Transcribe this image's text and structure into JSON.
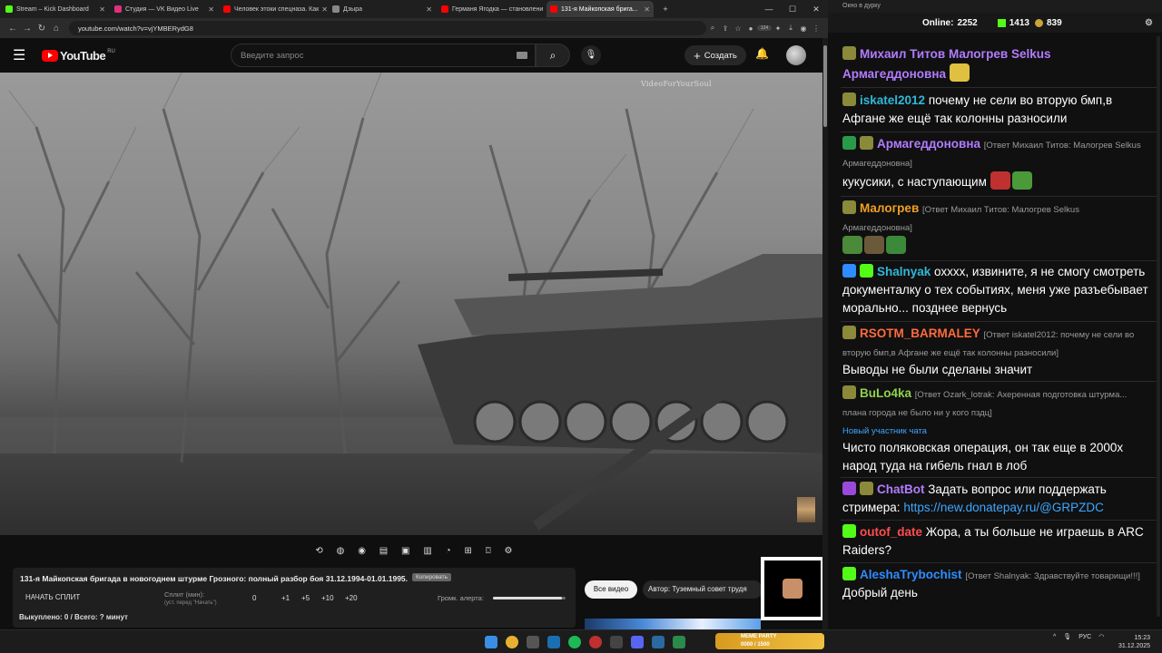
{
  "browser": {
    "tabs": [
      {
        "label": "Stream – Kick Dashboard",
        "color": "#53fc18"
      },
      {
        "label": "Студия — VK Видео Live",
        "color": "#e0307a"
      },
      {
        "label": "Человек этоки спецназа. Как",
        "color": "#ff0000"
      },
      {
        "label": "Дзыра",
        "color": "#888888"
      },
      {
        "label": "Германя Ягодка — становлени",
        "color": "#ff0000"
      },
      {
        "label": "131-я Майкопская брига...",
        "color": "#ff0000"
      }
    ],
    "url": "youtube.com/watch?v=vjYMBERydG8",
    "ext_badge": "124"
  },
  "youtube": {
    "logo_text": "YouTube",
    "region": "RU",
    "search_placeholder": "Введите запрос",
    "create_label": "Создать"
  },
  "video": {
    "watermark": "VideoForYourSoul"
  },
  "panel": {
    "title": "131-я Майкопская бригада в новогоднем штурме Грозного: полный разбор боя 31.12.1994-01.01.1995.",
    "badge": "Копировать",
    "split_button": "НАЧАТЬ СПЛИТ",
    "split_label": "Сплит (мин):",
    "split_sub": "(уст. перед \"Начать\")",
    "split_value": "0",
    "increments": [
      "+1",
      "+5",
      "+10",
      "+20"
    ],
    "alert_label": "Громк. алерта:",
    "alert_volume": 0.95,
    "bought": "Выкуплено: 0 / Всего: ? минут",
    "all_video": "Все видео",
    "author": "Автор: Туземный совет трудя"
  },
  "chat": {
    "window_title": "Окно в дурку",
    "online_label": "Online:",
    "online_value": "2252",
    "kick_count": "1413",
    "gold_count": "839",
    "messages": [
      {
        "name": "Михаил Титов",
        "text": "Малогрев Selkus Армагеддоновна",
        "color": "#b27cff"
      },
      {
        "name": "iskatel2012",
        "text": "почему не сели во вторую бмп,в Афгане же ещё так колонны разносили",
        "color": "#2fb8d9"
      },
      {
        "name": "Армагеддоновна",
        "reply": "[Ответ Михаил Титов: Малогрев Selkus Армагеддоновна]",
        "text": "кукусики, с наступающим",
        "color": "#b27cff"
      },
      {
        "name": "Малогрев",
        "reply": "[Ответ Михаил Титов: Малогрев Selkus Армагеддоновна]",
        "text": "",
        "color": "#f0a020"
      },
      {
        "name": "Shalnyak",
        "text": "охххх, извините, я не смогу смотреть документалку о тех событиях, меня уже разъебывает морально... позднее вернусь",
        "color": "#2fb8d9"
      },
      {
        "name": "RSOTM_BARMALEY",
        "reply": "[Ответ iskatel2012: почему не сели во вторую бмп,в Афгане же ещё так колонны разносили]",
        "text": "Выводы не были сделаны значит",
        "color": "#ff6a3d"
      },
      {
        "name": "BuLo4ka",
        "reply": "[Ответ Ozark_lotrak: Ахеренная подготовка штурма... плана города не было ни у кого пздц]",
        "new_member": "Новый участник чата",
        "text": "Чисто поляковская операция, он так еще в 2000х народ туда на гибель гнал в лоб",
        "color": "#8fd14f"
      },
      {
        "name": "ChatBot",
        "text": "Задать вопрос или поддержать стримера:",
        "link": "https://new.donatepay.ru/@GRPZDC",
        "color": "#b27cff"
      },
      {
        "name": "outof_date",
        "text": "Жора, а ты больше не играешь в ARC Raiders?",
        "color": "#ff4d4d"
      },
      {
        "name": "AleshaTrybochist",
        "reply": "[Ответ Shalnyak: Здравствуйте товарищи!!!]",
        "text": "Добрый день",
        "color": "#2f8cff"
      }
    ]
  },
  "taskbar": {
    "lang": "РУС",
    "time": "15:23",
    "date": "31.12.2025",
    "meme_title": "MEME PARTY",
    "meme_progress": "0000 / 1500"
  }
}
